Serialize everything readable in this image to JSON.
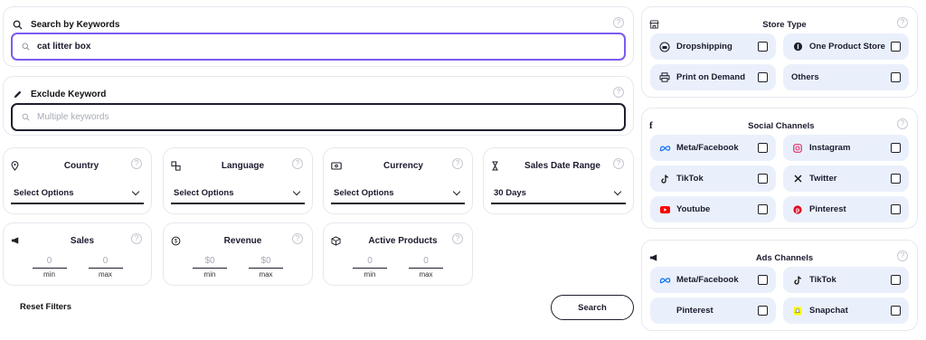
{
  "search_keywords": {
    "title": "Search by Keywords",
    "value": "cat litter box",
    "help": "?"
  },
  "exclude_keyword": {
    "title": "Exclude Keyword",
    "placeholder": "Multiple keywords",
    "help": "?"
  },
  "filters": {
    "country": {
      "title": "Country",
      "value": "Select Options",
      "help": "?"
    },
    "language": {
      "title": "Language",
      "value": "Select Options",
      "help": "?"
    },
    "currency": {
      "title": "Currency",
      "value": "Select Options",
      "help": "?"
    },
    "sales_date_range": {
      "title": "Sales Date Range",
      "value": "30 Days",
      "help": "?"
    },
    "sales": {
      "title": "Sales",
      "min": "0",
      "max": "0",
      "min_label": "min",
      "max_label": "max",
      "help": "?"
    },
    "revenue": {
      "title": "Revenue",
      "min": "$0",
      "max": "$0",
      "min_label": "min",
      "max_label": "max",
      "help": "?"
    },
    "active_products": {
      "title": "Active Products",
      "min": "0",
      "max": "0",
      "min_label": "min",
      "max_label": "max",
      "help": "?"
    }
  },
  "actions": {
    "reset_label": "Reset Filters",
    "search_label": "Search"
  },
  "store_type": {
    "title": "Store Type",
    "help": "?",
    "options": [
      {
        "label": "Dropshipping",
        "icon": "shipping-icon",
        "checked": false
      },
      {
        "label": "One Product Store",
        "icon": "single-product-icon",
        "checked": false
      },
      {
        "label": "Print on Demand",
        "icon": "printer-icon",
        "checked": false
      },
      {
        "label": "Others",
        "icon": "",
        "checked": false
      }
    ]
  },
  "social_channels": {
    "title": "Social Channels",
    "help": "?",
    "options": [
      {
        "label": "Meta/Facebook",
        "icon": "meta-icon",
        "color": "#1877f2",
        "checked": false
      },
      {
        "label": "Instagram",
        "icon": "instagram-icon",
        "color": "#e1306c",
        "checked": false
      },
      {
        "label": "TikTok",
        "icon": "tiktok-icon",
        "color": "#111111",
        "checked": false
      },
      {
        "label": "Twitter",
        "icon": "x-icon",
        "color": "#111111",
        "checked": false
      },
      {
        "label": "Youtube",
        "icon": "youtube-icon",
        "color": "#ff0000",
        "checked": false
      },
      {
        "label": "Pinterest",
        "icon": "pinterest-icon",
        "color": "#e60023",
        "checked": false
      }
    ]
  },
  "ads_channels": {
    "title": "Ads Channels",
    "help": "?",
    "options": [
      {
        "label": "Meta/Facebook",
        "icon": "meta-icon",
        "color": "#1877f2",
        "checked": false
      },
      {
        "label": "TikTok",
        "icon": "tiktok-icon",
        "color": "#111111",
        "checked": false
      },
      {
        "label": "Pinterest",
        "icon": "",
        "checked": false
      },
      {
        "label": "Snapchat",
        "icon": "snapchat-icon",
        "color": "#fffc00",
        "checked": false
      }
    ]
  },
  "colors": {
    "accent": "#7b5cf0",
    "option_bg": "#eaf0fb",
    "border": "#e6e8ef",
    "dark": "#1d1f2b"
  }
}
